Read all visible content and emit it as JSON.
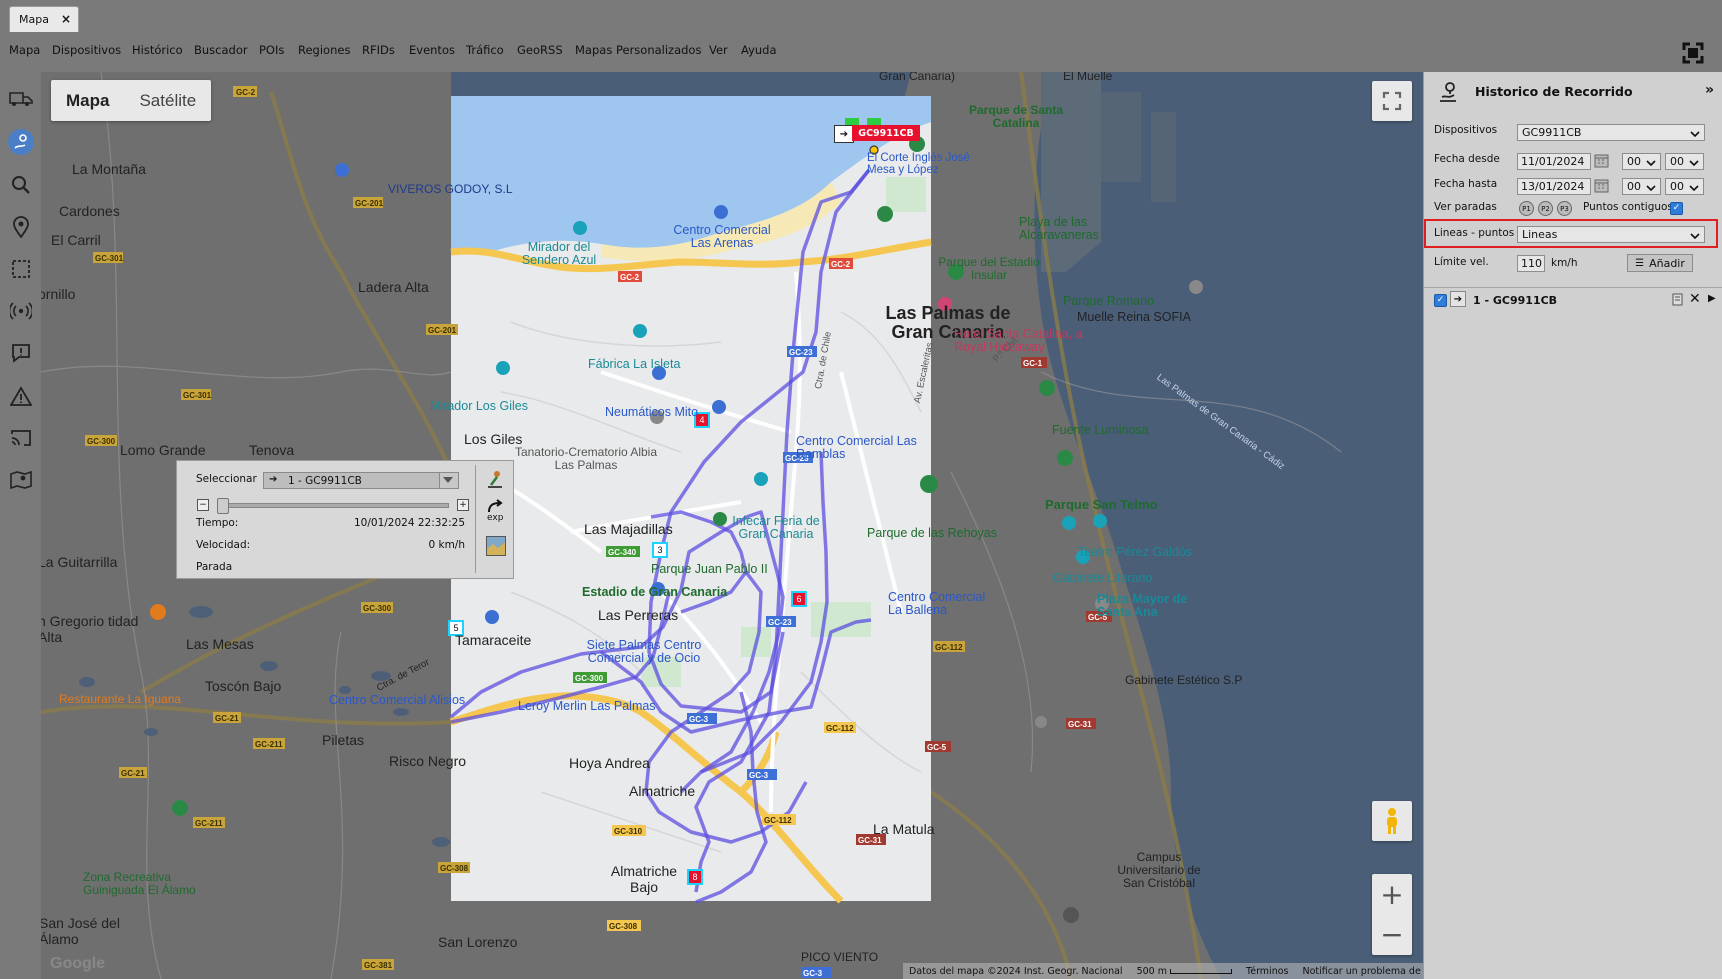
{
  "tab": {
    "label": "Mapa",
    "close": "×"
  },
  "menu": [
    "Mapa",
    "Dispositivos",
    "Histórico",
    "Buscador",
    "POIs",
    "Regiones",
    "RFIDs",
    "Eventos",
    "Tráfico",
    "GeoRSS",
    "Mapas Personalizados",
    "Ver",
    "Ayuda"
  ],
  "left_toolbar_icons": [
    "truck-icon",
    "route-history-icon",
    "search-icon",
    "poi-pin-icon",
    "region-select-icon",
    "rfid-signal-icon",
    "message-icon",
    "alert-icon",
    "cast-icon",
    "map-pin-icon"
  ],
  "map": {
    "type_buttons": {
      "map": "Mapa",
      "satellite": "Satélite"
    },
    "zoom_in": "+",
    "zoom_out": "−",
    "google_logo": "Google",
    "attribution": {
      "data": "Datos del mapa ©2024 Inst. Geogr. Nacional",
      "scale": "500 m",
      "terms": "Términos",
      "report": "Notificar un problema de Maps"
    },
    "vehicle_label": "GC9911CB",
    "stop_markers": [
      "3",
      "4",
      "5",
      "6",
      "8"
    ],
    "labels": [
      "Gran Canaria)",
      "El Muelle",
      "Parque de Santa Catalina",
      "El Corte Inglés José Mesa y López",
      "La Montaña",
      "VIVEROS GODOY, S.L",
      "Cardones",
      "El Carril",
      "ornillo",
      "Ladera Alta",
      "Mirador del Sendero Azul",
      "Centro Comercial Las Arenas",
      "Playa de las Alcaravaneras",
      "Parque del Estadio Insular",
      "Las Palmas de Gran Canaria",
      "Parque Romano",
      "Muelle Reina SOFIA",
      "Hotel Santa Catalina, a Royal Hideaway",
      "Fábrica La Isleta",
      "Mirador Los Giles",
      "Neumáticos Mito",
      "Los Giles",
      "Lomo Grande",
      "Tenova",
      "Tanatorio-Crematorio Albia Las Palmas",
      "Centro Comercial Las Ramblas",
      "Fuente Luminosa",
      "Las Majadillas",
      "Infecar Feria de Gran Canaria",
      "Parque de las Rehoyas",
      "Parque San Telmo",
      "La Guitarrilla",
      "Parque Juan Pablo II",
      "Teatro Pérez Galdós",
      "Gabinete Literario",
      "Estadio de Gran Canaria",
      "Centro Comercial La Ballena",
      "Plaza Mayor de Santa Ana",
      "n Gregorio tidad Alta",
      "Las Perreras",
      "Las Mesas",
      "Tamaraceite",
      "Siete Palmas Centro Comercial y de Ocio",
      "Gabinete Estético S.P",
      "Restaurante La Iguana",
      "Toscón Bajo",
      "Centro Comercial Alisios",
      "Leroy Merlin Las Palmas",
      "Piletas",
      "Risco Negro",
      "Hoya Andrea",
      "Almatriche",
      "La Matula",
      "Zona Recreativa Guiniguada El Álamo",
      "Almatriche Bajo",
      "Campus Universitario de San Cristóbal",
      "San José del Álamo",
      "San Lorenzo",
      "PICO VIENTO",
      "Av. Escaleritas",
      "Ctra. de Chile",
      "Ctra. de Teror",
      "Las Palmas de Gran Canaria - Cádiz",
      "P.º Chil"
    ],
    "road_badges": [
      "GC-2",
      "GC-201",
      "GC-301",
      "GC-300",
      "GC-340",
      "GC-23",
      "GC-21",
      "GC-211",
      "GC-308",
      "GC-310",
      "GC-112",
      "GC-5",
      "GC-31",
      "GC-1",
      "GC-381"
    ]
  },
  "player": {
    "select_label": "Seleccionar",
    "selected_device": "1 - GC9911CB",
    "time_label": "Tiempo:",
    "time_value": "10/01/2024 22:32:25",
    "speed_label": "Velocidad:",
    "speed_value": "0 km/h",
    "status": "Parada",
    "export_label": "exp",
    "progress": 0
  },
  "sidebar": {
    "title": "Historico de Recorrido",
    "collapse": "»",
    "devices_label": "Dispositivos",
    "devices_value": "GC9911CB",
    "date_from_label": "Fecha desde",
    "date_from": "11/01/2024",
    "date_from_h": "00",
    "date_from_m": "00",
    "date_to_label": "Fecha hasta",
    "date_to": "13/01/2024",
    "date_to_h": "00",
    "date_to_m": "00",
    "stops_label": "Ver paradas",
    "stop_buttons": [
      "P1",
      "P2",
      "P3"
    ],
    "contiguous_label": "Puntos contiguos",
    "lines_label": "Lineas - puntos",
    "lines_value": "Lineas",
    "speed_label": "Límite vel.",
    "speed_value": "110",
    "speed_unit": "km/h",
    "add_label": "Añadir",
    "entry": "1 - GC9911CB"
  },
  "colors": {
    "route": "#5b4fe0",
    "sea": "#9ec6ef",
    "road": "#f6c750",
    "highlight": "#e02020",
    "stop_marker": "#e8112d"
  }
}
